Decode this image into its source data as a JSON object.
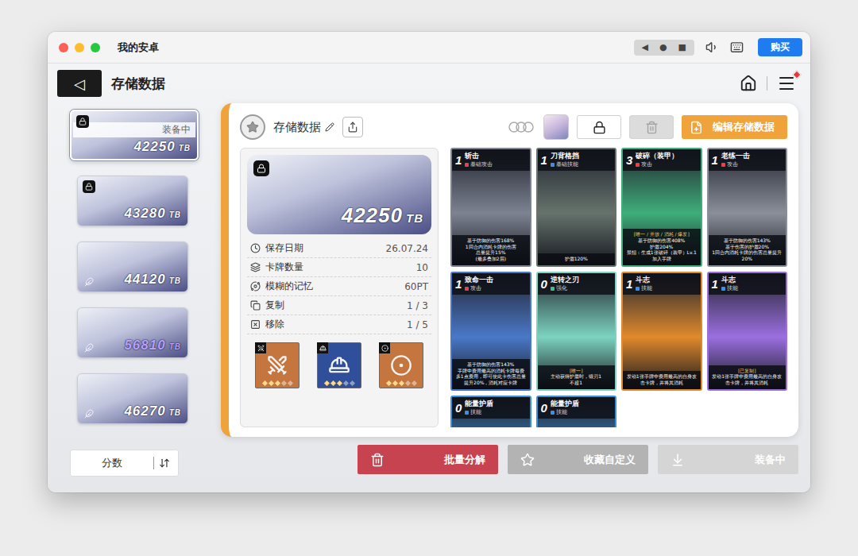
{
  "window": {
    "title": "我的安卓",
    "controls": [
      "◀",
      "●",
      "■"
    ],
    "buy_button": "购买"
  },
  "header": {
    "back": "◁",
    "title": "存储数据"
  },
  "saves": [
    {
      "value": "42250",
      "unit": "TB",
      "locked": true,
      "selected": true,
      "badge": "装备中",
      "color": "#ffffff"
    },
    {
      "value": "43280",
      "unit": "TB",
      "locked": true,
      "selected": false,
      "color": "#ffffff"
    },
    {
      "value": "44120",
      "unit": "TB",
      "locked": false,
      "selected": false,
      "color": "#ffffff"
    },
    {
      "value": "56810",
      "unit": "TB",
      "locked": false,
      "selected": false,
      "color": "#b9a0ff"
    },
    {
      "value": "46270",
      "unit": "TB",
      "locked": false,
      "selected": false,
      "color": "#ffffff"
    }
  ],
  "sort": {
    "label": "分数"
  },
  "panel": {
    "title": "存储数据",
    "locked": true,
    "trash_disabled": true,
    "edit_button": "编辑存储数据"
  },
  "info": {
    "locked": true,
    "value": "42250",
    "unit": "TB",
    "rows": [
      {
        "label": "保存日期",
        "value": "26.07.24"
      },
      {
        "label": "卡牌数量",
        "value": "10"
      },
      {
        "label": "模糊的记忆",
        "value": "60PT"
      },
      {
        "label": "复制",
        "value": "1 / 3"
      },
      {
        "label": "移除",
        "value": "1 / 5"
      }
    ],
    "items": [
      {
        "kind": "sword",
        "stars": 3,
        "color": "#c5763f"
      },
      {
        "kind": "helmet",
        "stars": 3,
        "color": "#2f4f9a"
      },
      {
        "kind": "ring",
        "stars": 3,
        "color": "#c5763f"
      }
    ]
  },
  "cards": [
    {
      "cost": "1",
      "name": "斩击",
      "type": "基础攻击",
      "kind": "attack",
      "color": "#7d8391",
      "lines": [
        "基于防御的伤害168%",
        "1回合内消耗卡牌的伤害",
        "总量提升15%",
        "(最多叠加2层)"
      ]
    },
    {
      "cost": "1",
      "name": "刀背格挡",
      "type": "基础技能",
      "kind": "skill",
      "color": "#66736d",
      "lines": [
        "护盾120%"
      ]
    },
    {
      "cost": "3",
      "name": "破碎（装甲）",
      "type": "攻击",
      "kind": "attack",
      "color": "#3fae7a",
      "tag": "[唯一 / 开放 / 消耗 / 爆发]",
      "lines": [
        "基于防御的伤害408%",
        "护盾204%",
        "禁招：生成1张破碎（装甲）Lv.1加入手牌"
      ]
    },
    {
      "cost": "1",
      "name": "老练一击",
      "type": "攻击",
      "kind": "attack",
      "color": "#8a8f99",
      "lines": [
        "基于防御的伤害143%",
        "基于伤害的护盾20%",
        "1回合内消耗卡牌的伤害总量提升20%"
      ]
    },
    {
      "cost": "1",
      "name": "致命一击",
      "type": "攻击",
      "kind": "attack",
      "color": "#4a78c8",
      "lines": [
        "基于防御的伤害143%",
        "手牌中费用最高的消耗卡牌每费多1点费用，即可使此卡伤害总量提升20%，消耗对应卡牌"
      ]
    },
    {
      "cost": "0",
      "name": "逆转之刃",
      "type": "强化",
      "kind": "buff",
      "color": "#7dd3c0",
      "tag": "[唯一]",
      "lines": [
        "主动获得护盾时，锻刃1",
        "不超1"
      ]
    },
    {
      "cost": "1",
      "name": "斗志",
      "type": "技能",
      "kind": "skill",
      "color": "#e08a2c",
      "lines": [
        "发动1张手牌中费用最高的自身攻击卡牌，并将其消耗"
      ]
    },
    {
      "cost": "1",
      "name": "斗志",
      "type": "技能",
      "kind": "skill",
      "color": "#9b6fe0",
      "tag": "[已复制]",
      "lines": [
        "发动1张手牌中费用最高的自身攻击卡牌，并将其消耗"
      ]
    },
    {
      "cost": "0",
      "name": "能量护盾",
      "type": "技能",
      "kind": "skill",
      "color": "#3a8fd8",
      "lines": []
    },
    {
      "cost": "0",
      "name": "能量护盾",
      "type": "技能",
      "kind": "skill",
      "color": "#3a8fd8",
      "lines": []
    }
  ],
  "actions": [
    {
      "label": "批量分解",
      "kind": "dismantle",
      "disabled": false
    },
    {
      "label": "收藏自定义",
      "kind": "custom",
      "disabled": false
    },
    {
      "label": "装备中",
      "kind": "equip",
      "disabled": true
    }
  ]
}
